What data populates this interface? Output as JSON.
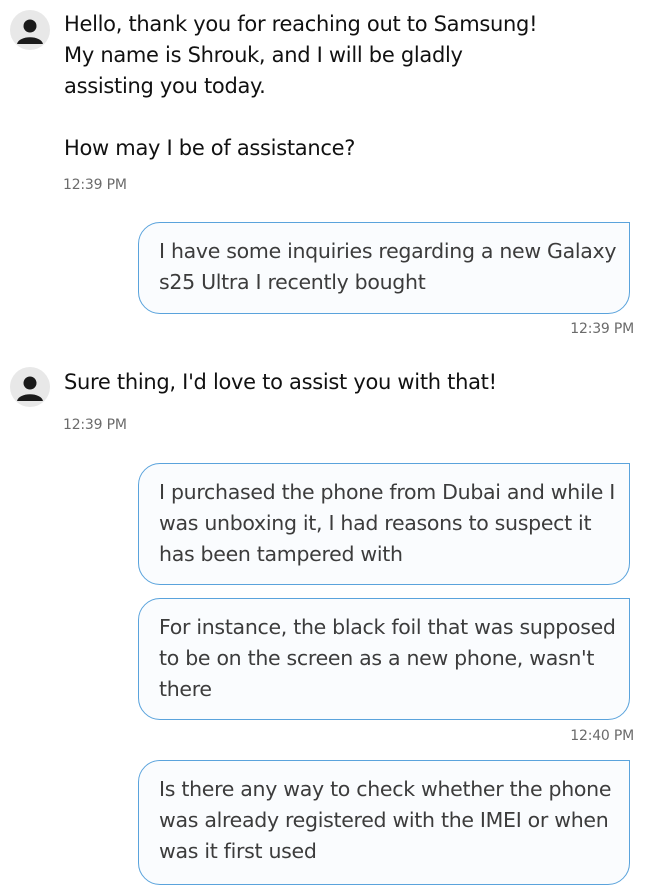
{
  "messages": {
    "agent_greeting": {
      "text": "Hello, thank you for reaching out to Samsung!\nMy name is Shrouk, and I will be gladly\nassisting you today.\n\nHow may I be of assistance?",
      "time": "12:39 PM"
    },
    "user_inquiry": {
      "text": "I have some inquiries regarding a new Galaxy s25 Ultra I recently bought",
      "time": "12:39 PM"
    },
    "agent_reply": {
      "text": "Sure thing, I'd love to assist you with that!",
      "time": "12:39 PM"
    },
    "user_purchase": {
      "text": "I purchased the phone from Dubai and while I was unboxing it, I had reasons to suspect it has been tampered with"
    },
    "user_foil": {
      "text": "For instance, the black foil that was supposed to be on the screen as a new phone, wasn't there",
      "time": "12:40 PM"
    },
    "user_imei": {
      "text": "Is there any way to check whether the phone was already registered with the IMEI or when was it first used"
    }
  },
  "colors": {
    "bubble_border": "#5aa3dc",
    "bubble_background": "#fafcfe",
    "avatar_background": "#e8e8e8",
    "avatar_icon": "#1a1a1a"
  },
  "icons": {
    "agent_avatar": "person-icon"
  }
}
